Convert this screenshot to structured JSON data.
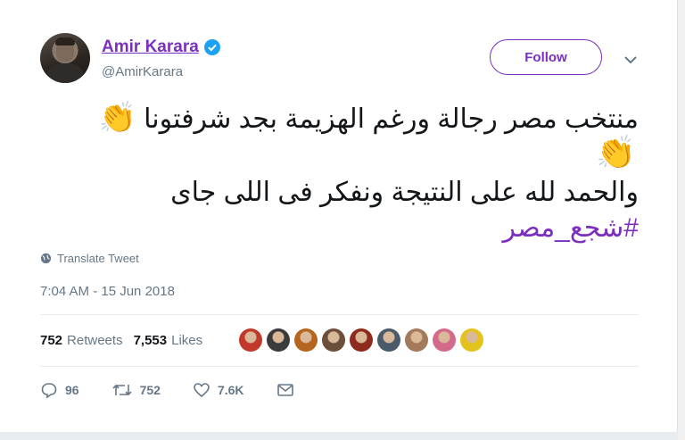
{
  "user": {
    "name": "Amir Karara",
    "handle": "@AmirKarara"
  },
  "follow_label": "Follow",
  "tweet": {
    "line1": "منتخب مصر رجالة ورغم الهزيمة بجد شرفتونا",
    "line2": "والحمد لله على النتيجة ونفكر فى اللى جاى",
    "hashtag": "#شجع_مصر",
    "emoji": "👏"
  },
  "translate_label": "Translate Tweet",
  "timestamp": "7:04 AM - 15 Jun 2018",
  "stats": {
    "retweets_count": "752",
    "retweets_label": "Retweets",
    "likes_count": "7,553",
    "likes_label": "Likes"
  },
  "liker_avatars": [
    {
      "color": "#c0392b"
    },
    {
      "color": "#3b3b3b"
    },
    {
      "color": "#b5651d"
    },
    {
      "color": "#6b4f3a"
    },
    {
      "color": "#8e2b1f"
    },
    {
      "color": "#4a5a6a"
    },
    {
      "color": "#a37b5c"
    },
    {
      "color": "#d46a8a"
    },
    {
      "color": "#e3c21c"
    }
  ],
  "actions": {
    "replies": "96",
    "retweets": "752",
    "likes": "7.6K"
  },
  "colors": {
    "accent": "#7b2fbe",
    "verified": "#1da1f2",
    "muted": "#657786"
  }
}
